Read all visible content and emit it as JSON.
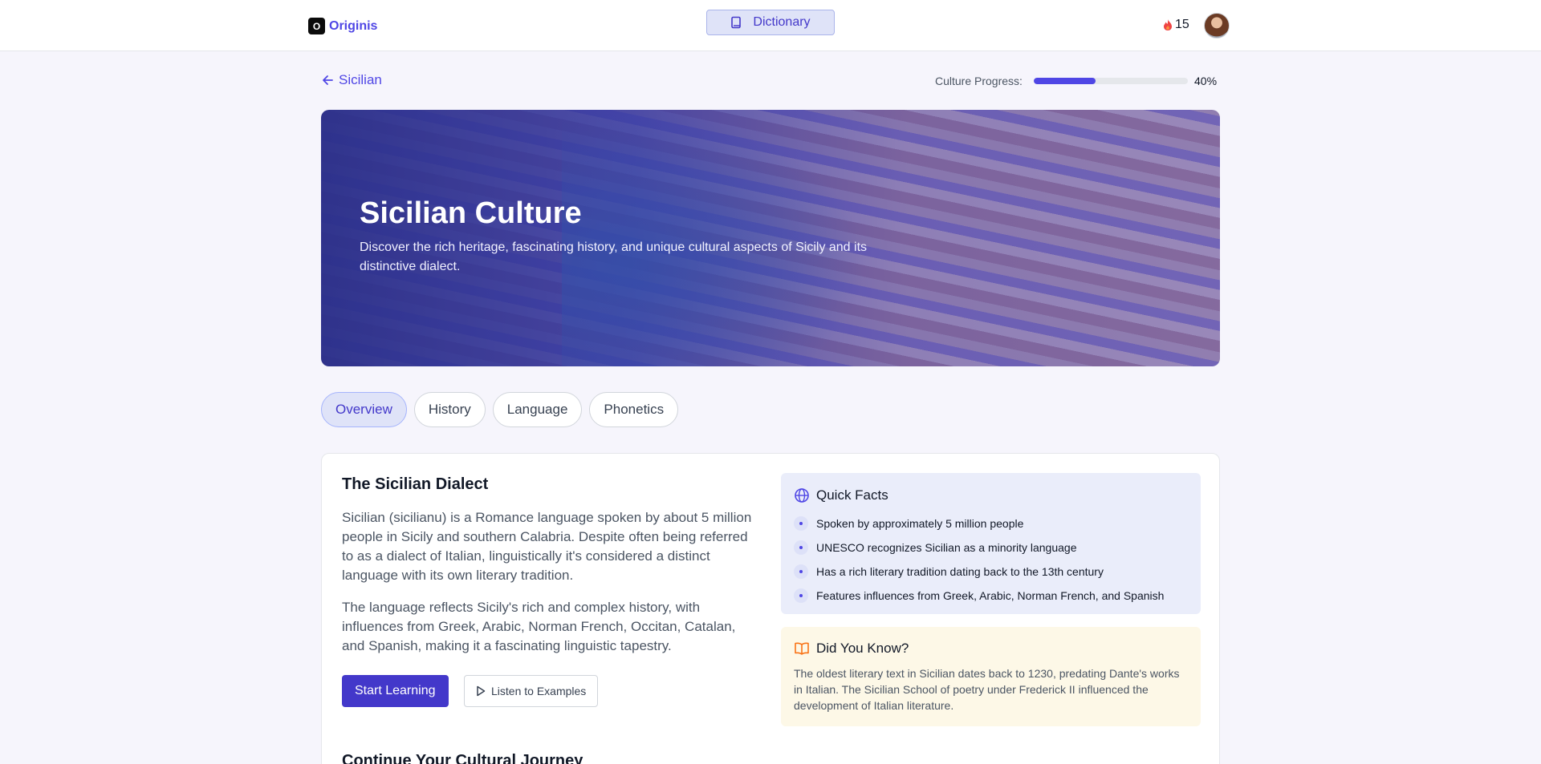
{
  "header": {
    "logo_letter": "O",
    "brand": "Originis",
    "dictionary_label": "Dictionary",
    "streak_count": "15"
  },
  "nav": {
    "back_label": "Sicilian"
  },
  "progress": {
    "label": "Culture Progress:",
    "value_text": "40%",
    "value": 0.4
  },
  "hero": {
    "title": "Sicilian Culture",
    "subtitle": "Discover the rich heritage, fascinating history, and unique cultural aspects of Sicily and its distinctive dialect."
  },
  "tabs": [
    {
      "label": "Overview",
      "active": true
    },
    {
      "label": "History",
      "active": false
    },
    {
      "label": "Language",
      "active": false
    },
    {
      "label": "Phonetics",
      "active": false
    }
  ],
  "main": {
    "title": "The Sicilian Dialect",
    "paragraph1": "Sicilian (sicilianu) is a Romance language spoken by about 5 million people in Sicily and southern Calabria. Despite often being referred to as a dialect of Italian, linguistically it's considered a distinct language with its own literary tradition.",
    "paragraph2": "The language reflects Sicily's rich and complex history, with influences from Greek, Arabic, Norman French, Occitan, Catalan, and Spanish, making it a fascinating linguistic tapestry.",
    "start_button": "Start Learning",
    "listen_button": "Listen to Examples",
    "continue_title": "Continue Your Cultural Journey"
  },
  "quick_facts": {
    "title": "Quick Facts",
    "items": [
      "Spoken by approximately 5 million people",
      "UNESCO recognizes Sicilian as a minority language",
      "Has a rich literary tradition dating back to the 13th century",
      "Features influences from Greek, Arabic, Norman French, and Spanish"
    ]
  },
  "did_you_know": {
    "title": "Did You Know?",
    "text": "The oldest literary text in Sicilian dates back to 1230, predating Dante's works in Italian. The Sicilian School of poetry under Frederick II influenced the development of Italian literature."
  },
  "colors": {
    "accent": "#4f46e5",
    "primary_button": "#4338ca",
    "facts_bg": "#eaedfa",
    "dyk_bg": "#fdf8e7",
    "dyk_icon": "#f97316"
  },
  "icons": {
    "dictionary": "book-icon",
    "streak": "flame-icon",
    "back": "arrow-left-icon",
    "listen": "play-icon",
    "facts": "globe-icon",
    "dyk": "open-book-icon"
  }
}
